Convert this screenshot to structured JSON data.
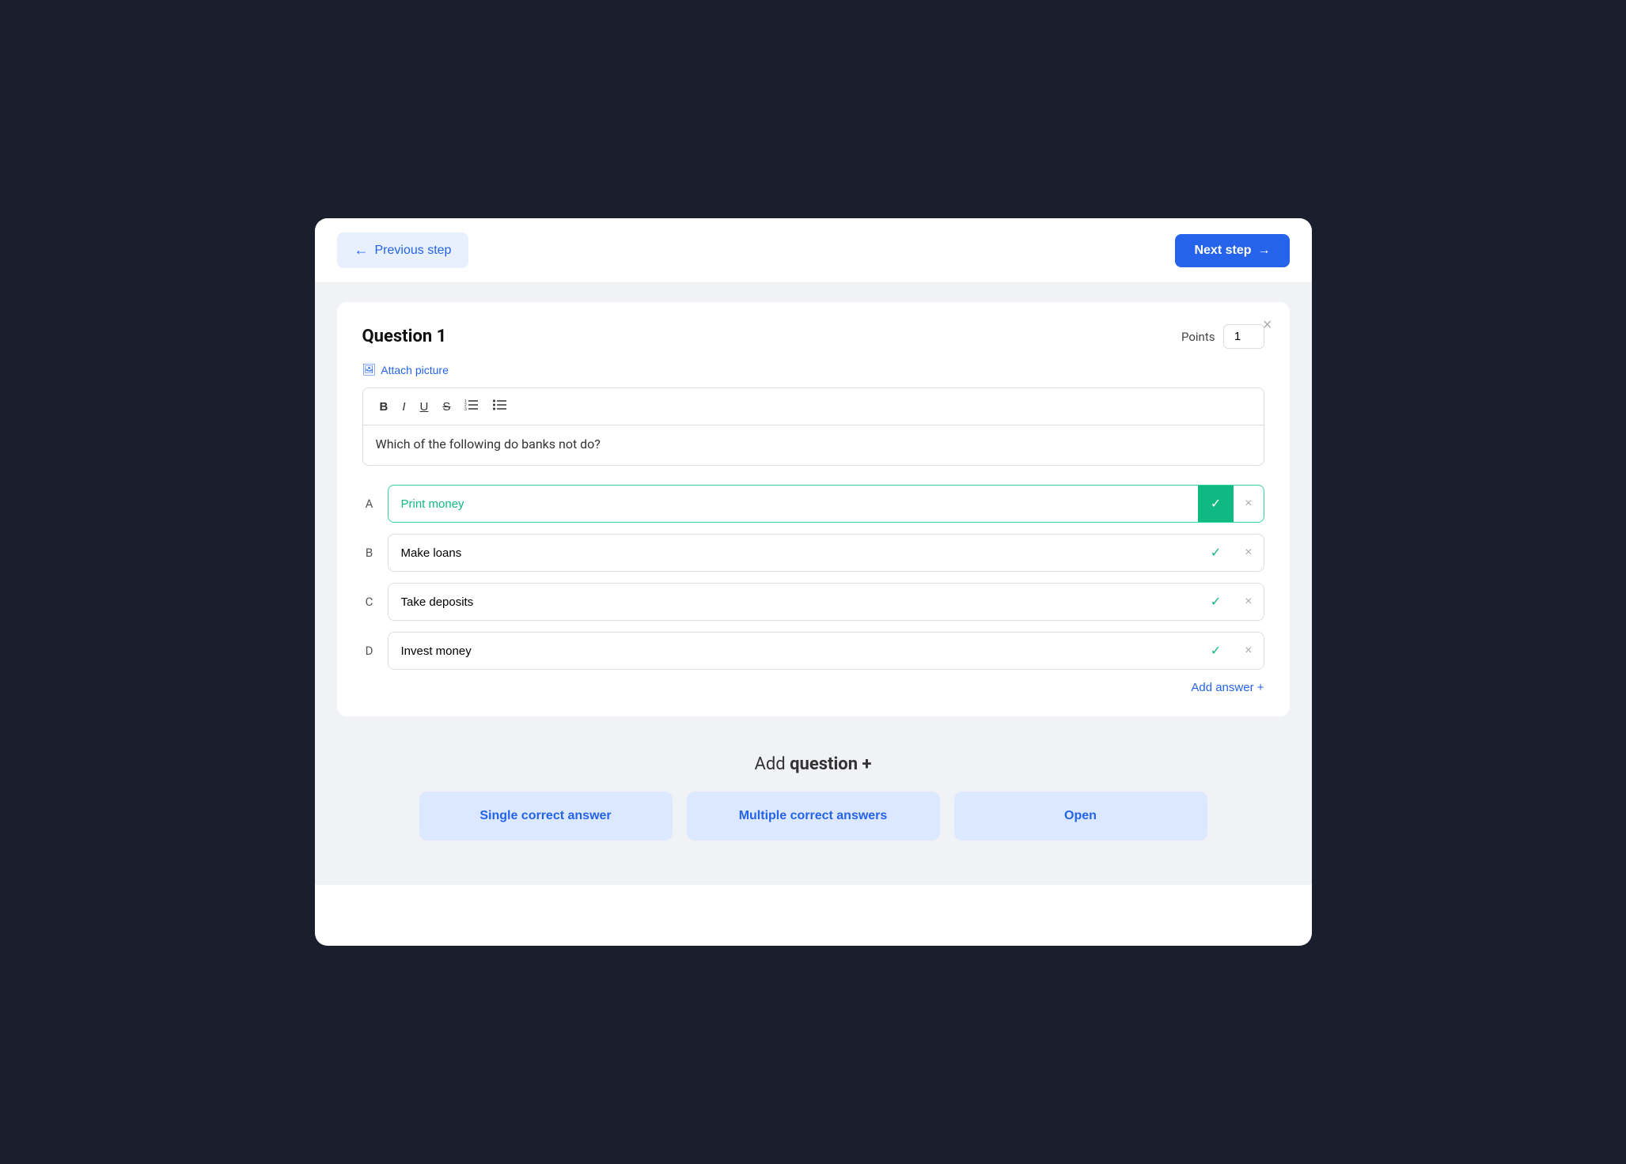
{
  "navigation": {
    "prev_label": "Previous step",
    "next_label": "Next step",
    "prev_arrow": "←",
    "next_arrow": "→"
  },
  "question": {
    "title": "Question 1",
    "points_label": "Points",
    "points_value": "1",
    "attach_label": "Attach picture",
    "close_icon": "×",
    "toolbar": {
      "bold": "B",
      "italic": "I",
      "underline": "U",
      "strikethrough": "S",
      "ordered_list": "≡",
      "unordered_list": "≡"
    },
    "question_text": "Which of the following do banks not do?",
    "answers": [
      {
        "label": "A",
        "text": "Print money",
        "correct": true,
        "active": true
      },
      {
        "label": "B",
        "text": "Make loans",
        "correct": false,
        "active": false
      },
      {
        "label": "C",
        "text": "Take deposits",
        "correct": false,
        "active": false
      },
      {
        "label": "D",
        "text": "Invest money",
        "correct": false,
        "active": false
      }
    ],
    "add_answer_label": "Add answer +"
  },
  "add_question": {
    "title_plain": "Add ",
    "title_bold": "question +",
    "type_buttons": [
      {
        "label": "Single correct answer"
      },
      {
        "label": "Multiple correct answers"
      },
      {
        "label": "Open"
      }
    ]
  }
}
